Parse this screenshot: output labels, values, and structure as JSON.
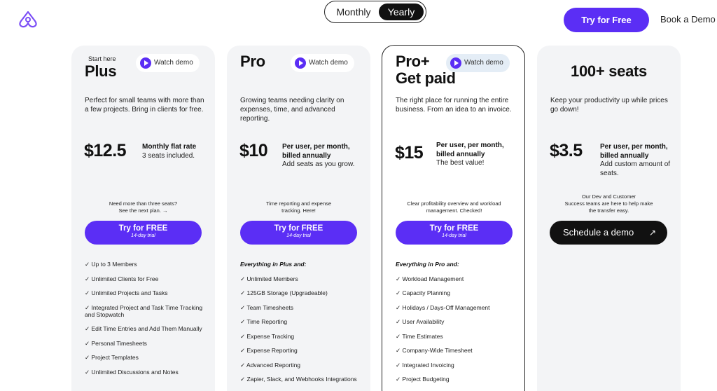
{
  "header": {
    "billing_toggle": {
      "monthly": "Monthly",
      "yearly": "Yearly",
      "selected": "Yearly"
    },
    "try_free": "Try for Free",
    "book_demo": "Book a Demo"
  },
  "colors": {
    "accent": "#5b2ef5",
    "dark": "#111111",
    "card_bg": "#f3f4f6"
  },
  "plans": [
    {
      "eyebrow": "Start here",
      "name": "Plus",
      "watch_demo": "Watch demo",
      "description": "Perfect for small teams with more than a few projects. Bring in clients for free.",
      "price": "$12.5",
      "price_note_bold": "Monthly flat rate",
      "price_note": "3 seats included.",
      "note_line1": "Need more than three seats?",
      "note_line2": "See the next plan. →",
      "cta": "Try for FREE",
      "cta_sub": "14-day trial",
      "features": [
        "✓ Up to 3 Members",
        "✓ Unlimited Clients for Free",
        "✓ Unlimited Projects and Tasks",
        "✓ Integrated Project and Task Time Tracking and Stopwatch",
        "✓ Edit Time Entries and Add Them Manually",
        "✓ Personal Timesheets",
        "✓ Project Templates",
        "✓ Unlimited Discussions and Notes"
      ]
    },
    {
      "name": "Pro",
      "watch_demo": "Watch demo",
      "description": "Growing teams needing clarity on expenses, time, and advanced reporting.",
      "price": "$10",
      "price_note_bold": "Per user, per month, billed annually",
      "price_note": "Add seats as you grow.",
      "note_line1": "Time reporting and expense",
      "note_line2": "tracking. Here!",
      "cta": "Try for FREE",
      "cta_sub": "14-day trial",
      "features_head": "Everything in Plus and:",
      "features": [
        "✓ Unlimited Members",
        "✓ 125GB Storage (Upgradeable)",
        "✓ Team Timesheets",
        "✓ Time Reporting",
        "✓ Expense Tracking",
        "✓ Expense Reporting",
        "✓ Advanced Reporting",
        "✓ Zapier, Slack, and Webhooks Integrations"
      ]
    },
    {
      "name_line1": "Pro+",
      "name_line2": "Get paid",
      "watch_demo": "Watch demo",
      "description": "The right place for running the entire business. From an idea to an invoice.",
      "price": "$15",
      "price_note_bold": "Per user, per month, billed annually",
      "price_note": "The best value!",
      "note_line1": "Clear profitability overview and workload",
      "note_line2": "management. Checked!",
      "cta": "Try for FREE",
      "cta_sub": "14-day trial",
      "features_head": "Everything in Pro and:",
      "features": [
        "✓ Workload Management",
        "✓ Capacity Planning",
        "✓ Holidays / Days-Off Management",
        "✓ User Availability",
        "✓ Time Estimates",
        "✓ Company-Wide Timesheet",
        "✓ Integrated Invoicing",
        "✓ Project Budgeting"
      ]
    },
    {
      "name": "100+ seats",
      "description": "Keep your productivity up while prices go down!",
      "price": "$3.5",
      "price_note_bold": "Per user, per month, billed annually",
      "price_note": "Add custom amount of seats.",
      "note_line1": "Our Dev and Customer",
      "note_line2": "Success teams are here to help make",
      "note_line3": "the transfer easy.",
      "cta": "Schedule a demo",
      "cta_arrow": "↗"
    }
  ]
}
